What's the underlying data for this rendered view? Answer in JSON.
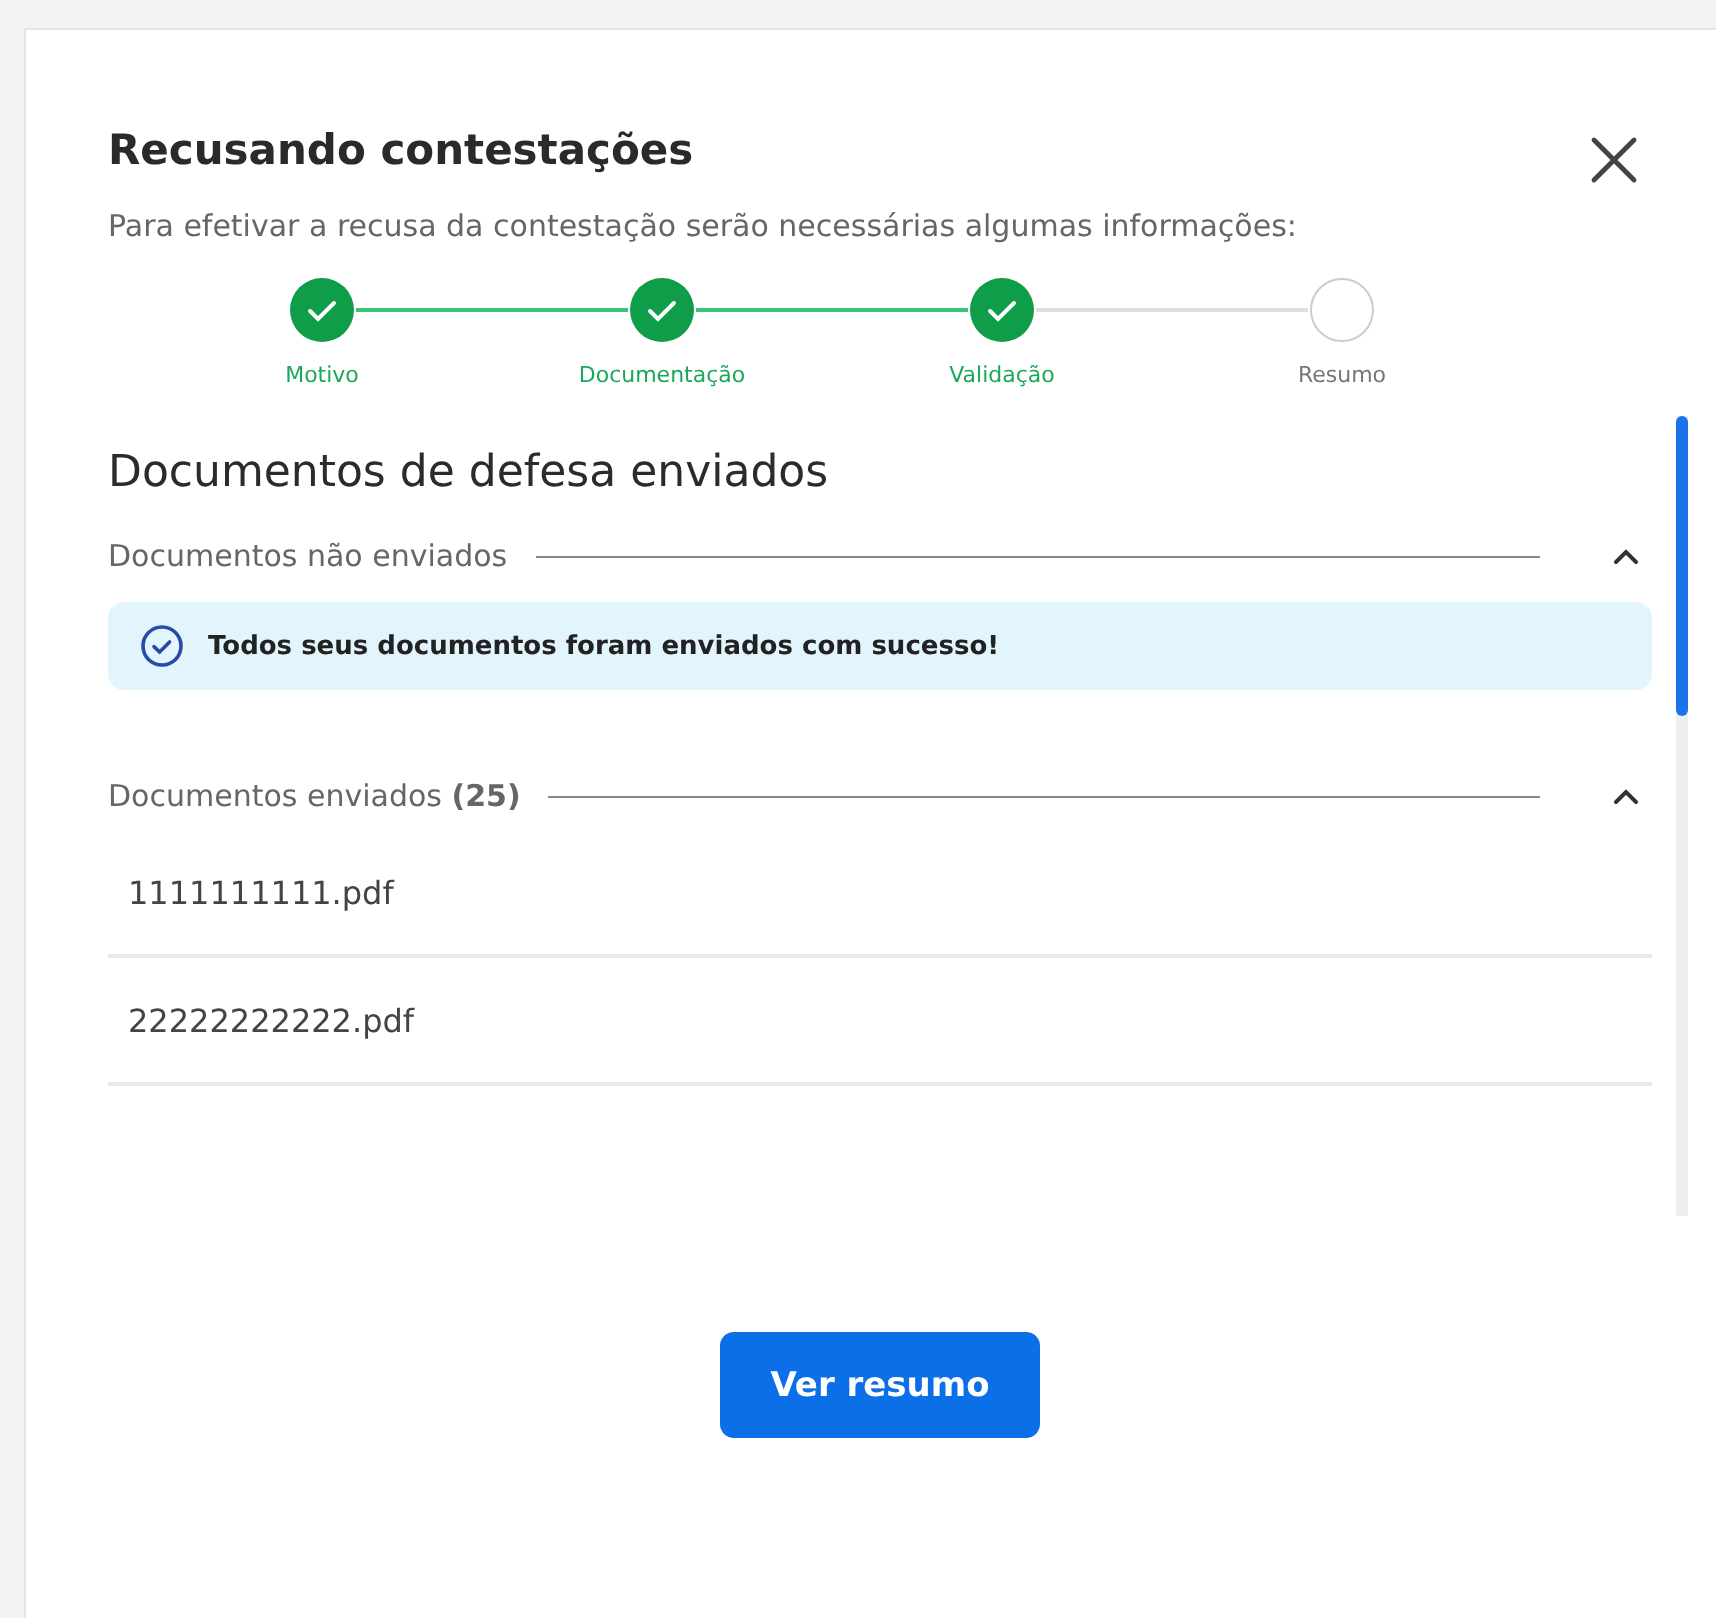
{
  "dialog": {
    "title": "Recusando contestações",
    "subtitle": "Para efetivar a recusa da contestação serão necessárias algumas informações:"
  },
  "steps": [
    {
      "label": "Motivo",
      "done": true
    },
    {
      "label": "Documentação",
      "done": true
    },
    {
      "label": "Validação",
      "done": true
    },
    {
      "label": "Resumo",
      "done": false
    }
  ],
  "content": {
    "heading": "Documentos de defesa enviados",
    "sections": [
      {
        "kind": "alert",
        "title": "Documentos não enviados",
        "expanded": true,
        "message": "Todos seus documentos foram enviados com sucesso!"
      },
      {
        "kind": "files",
        "title": "Documentos enviados **(25)**",
        "expanded": true,
        "files": [
          "1111111111.pdf",
          "22222222222.pdf"
        ]
      }
    ]
  },
  "primary_button": "Ver resumo"
}
